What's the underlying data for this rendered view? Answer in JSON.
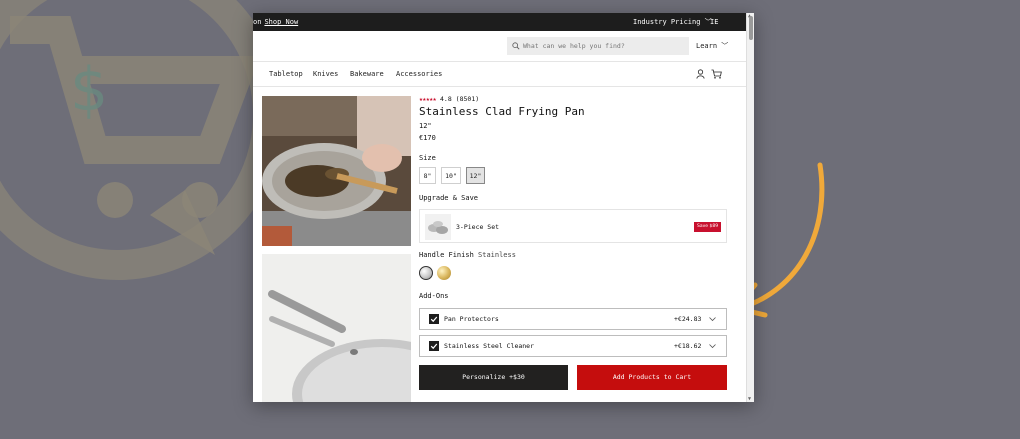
{
  "topbar": {
    "promo_text": "on",
    "promo_link": "Shop Now",
    "pricing": "Industry Pricing",
    "region": "IE"
  },
  "header": {
    "search_placeholder": "What can we help you find?",
    "learn": "Learn"
  },
  "nav": {
    "items": [
      "Tabletop",
      "Knives",
      "Bakeware",
      "Accessories"
    ]
  },
  "product": {
    "rating": "4.8",
    "reviews": "(8501)",
    "stars": "★★★★★",
    "title": "Stainless Clad Frying Pan",
    "selected_size": "12\"",
    "price": "€170"
  },
  "size": {
    "label": "Size",
    "options": [
      "8\"",
      "10\"",
      "12\""
    ],
    "selected_index": 2
  },
  "upgrade": {
    "label": "Upgrade & Save",
    "item_name": "3-Piece Set",
    "badge": "Save $89"
  },
  "handle": {
    "label": "Handle Finish",
    "value": "Stainless",
    "swatches": [
      "Stainless",
      "Gold"
    ]
  },
  "addons": {
    "label": "Add-Ons",
    "items": [
      {
        "name": "Pan Protectors",
        "price": "+€24.83",
        "checked": true
      },
      {
        "name": "Stainless Steel Cleaner",
        "price": "+€18.62",
        "checked": true
      }
    ]
  },
  "buttons": {
    "personalize": "Personalize +$30",
    "add_to_cart": "Add Products to Cart"
  },
  "colors": {
    "accent_red": "#c50d0d",
    "topbar_bg": "#1d1d1d",
    "arrow": "#f0a93a"
  }
}
